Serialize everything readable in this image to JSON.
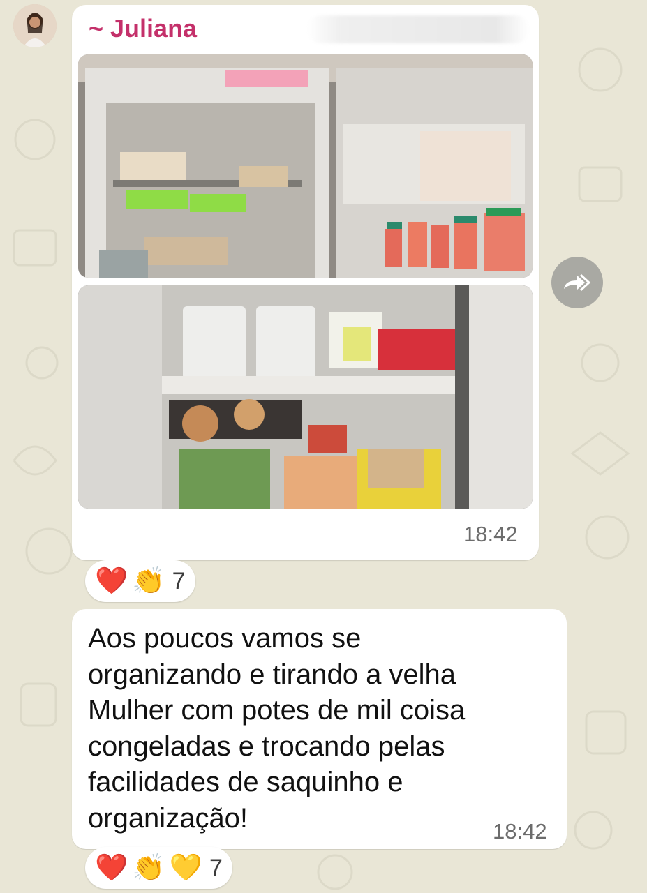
{
  "message_image": {
    "sender": "~ Juliana",
    "time": "18:42",
    "photos": [
      "fridge-freezer-top",
      "fridge-shelves-bottom"
    ],
    "reactions": {
      "emojis": [
        "❤️",
        "👏"
      ],
      "count": "7"
    }
  },
  "message_text": {
    "lines": [
      "Aos poucos vamos se",
      "organizando e tirando a velha",
      "Mulher com potes de mil coisa",
      "congeladas e trocando pelas",
      "facilidades de saquinho e",
      "organização!"
    ],
    "time": "18:42",
    "reactions": {
      "emojis": [
        "❤️",
        "👏",
        "💛"
      ],
      "count": "7"
    }
  },
  "colors": {
    "sender_name": "#c4306a",
    "wallpaper": "#e9e6d6",
    "bubble": "#ffffff",
    "forward_button": "#a9a9a3"
  },
  "icons": {
    "forward": "forward-icon",
    "avatar": "avatar"
  }
}
